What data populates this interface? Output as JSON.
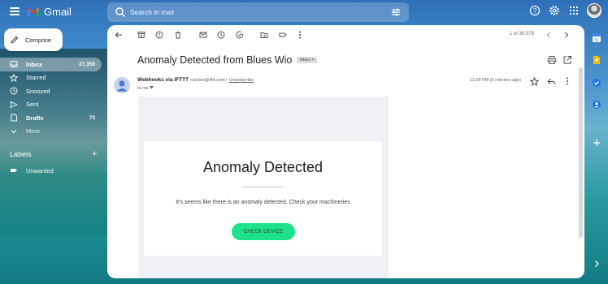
{
  "header": {
    "app_name": "Gmail",
    "search_placeholder": "Search in mail"
  },
  "sidebar": {
    "compose_label": "Compose",
    "items": [
      {
        "label": "Inbox",
        "count": "27,359",
        "icon": "inbox-icon",
        "active": true
      },
      {
        "label": "Starred",
        "count": "",
        "icon": "star-icon"
      },
      {
        "label": "Snoozed",
        "count": "",
        "icon": "clock-icon"
      },
      {
        "label": "Sent",
        "count": "",
        "icon": "send-icon"
      },
      {
        "label": "Drafts",
        "count": "73",
        "icon": "draft-icon"
      },
      {
        "label": "More",
        "count": "",
        "icon": "chevron-down-icon"
      }
    ],
    "labels_heading": "Labels",
    "labels_add": "+",
    "labels": [
      {
        "label": "Unwanted",
        "icon": "label-icon"
      }
    ]
  },
  "toolbar": {
    "pager_text": "1 of 30,079"
  },
  "email": {
    "subject": "Anomaly Detected from Blues Wio",
    "folder_chip": "Inbox",
    "chip_close": "×",
    "sender_name": "Webhooks via IFTTT",
    "sender_email": "<action@ifttt.com>",
    "unsubscribe": "Unsubscribe",
    "recipient": "to me",
    "time": "11:09 PM (5 minutes ago)",
    "body": {
      "title": "Anomaly Detected",
      "text": "It's seems like there is an anomaly detected, Check your machineries",
      "button": "CHECK DEVICE"
    }
  },
  "colors": {
    "button_green": "#1de28a",
    "gmail_red": "#ea4335",
    "panel_bg": "#ffffff"
  }
}
